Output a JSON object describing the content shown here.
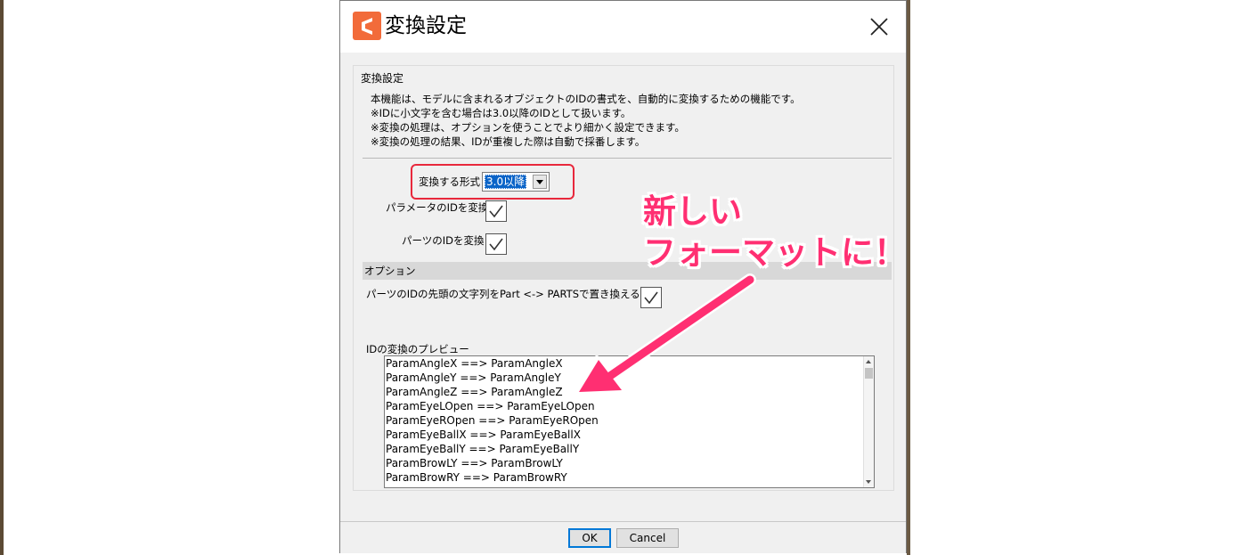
{
  "window": {
    "title": "変換設定"
  },
  "section": {
    "label": "変換設定",
    "description": [
      "本機能は、モデルに含まれるオブジェクトのIDの書式を、自動的に変換するための機能です。",
      "※IDに小文字を含む場合は3.0以降のIDとして扱います。",
      "※変換の処理は、オプションを使うことでより細かく設定できます。",
      "※変換の処理の結果、IDが重複した際は自動で採番します。"
    ]
  },
  "format": {
    "label": "変換する形式",
    "selected": "3.0以降"
  },
  "checks": {
    "param_label": "パラメータのIDを変換",
    "param_checked": true,
    "parts_label": "パーツのIDを変換",
    "parts_checked": true
  },
  "options": {
    "header": "オプション",
    "part_prefix_label": "パーツのIDの先頭の文字列をPart <-> PARTSで置き換える",
    "part_prefix_checked": true
  },
  "preview": {
    "label": "IDの変換のプレビュー",
    "items": [
      "ParamAngleX ==> ParamAngleX",
      "ParamAngleY ==> ParamAngleY",
      "ParamAngleZ ==> ParamAngleZ",
      "ParamEyeLOpen ==> ParamEyeLOpen",
      "ParamEyeROpen ==> ParamEyeROpen",
      "ParamEyeBallX ==> ParamEyeBallX",
      "ParamEyeBallY ==> ParamEyeBallY",
      "ParamBrowLY ==> ParamBrowLY",
      "ParamBrowRY ==> ParamBrowRY"
    ]
  },
  "footer": {
    "ok_label": "OK",
    "cancel_label": "Cancel"
  },
  "annotation": {
    "line1": "新しい",
    "line2": "フォーマットに！",
    "color": "#ff2f72"
  },
  "colors": {
    "app_icon": "#f26b3a",
    "highlight_border": "#e8283c",
    "selection": "#0a64c8"
  }
}
